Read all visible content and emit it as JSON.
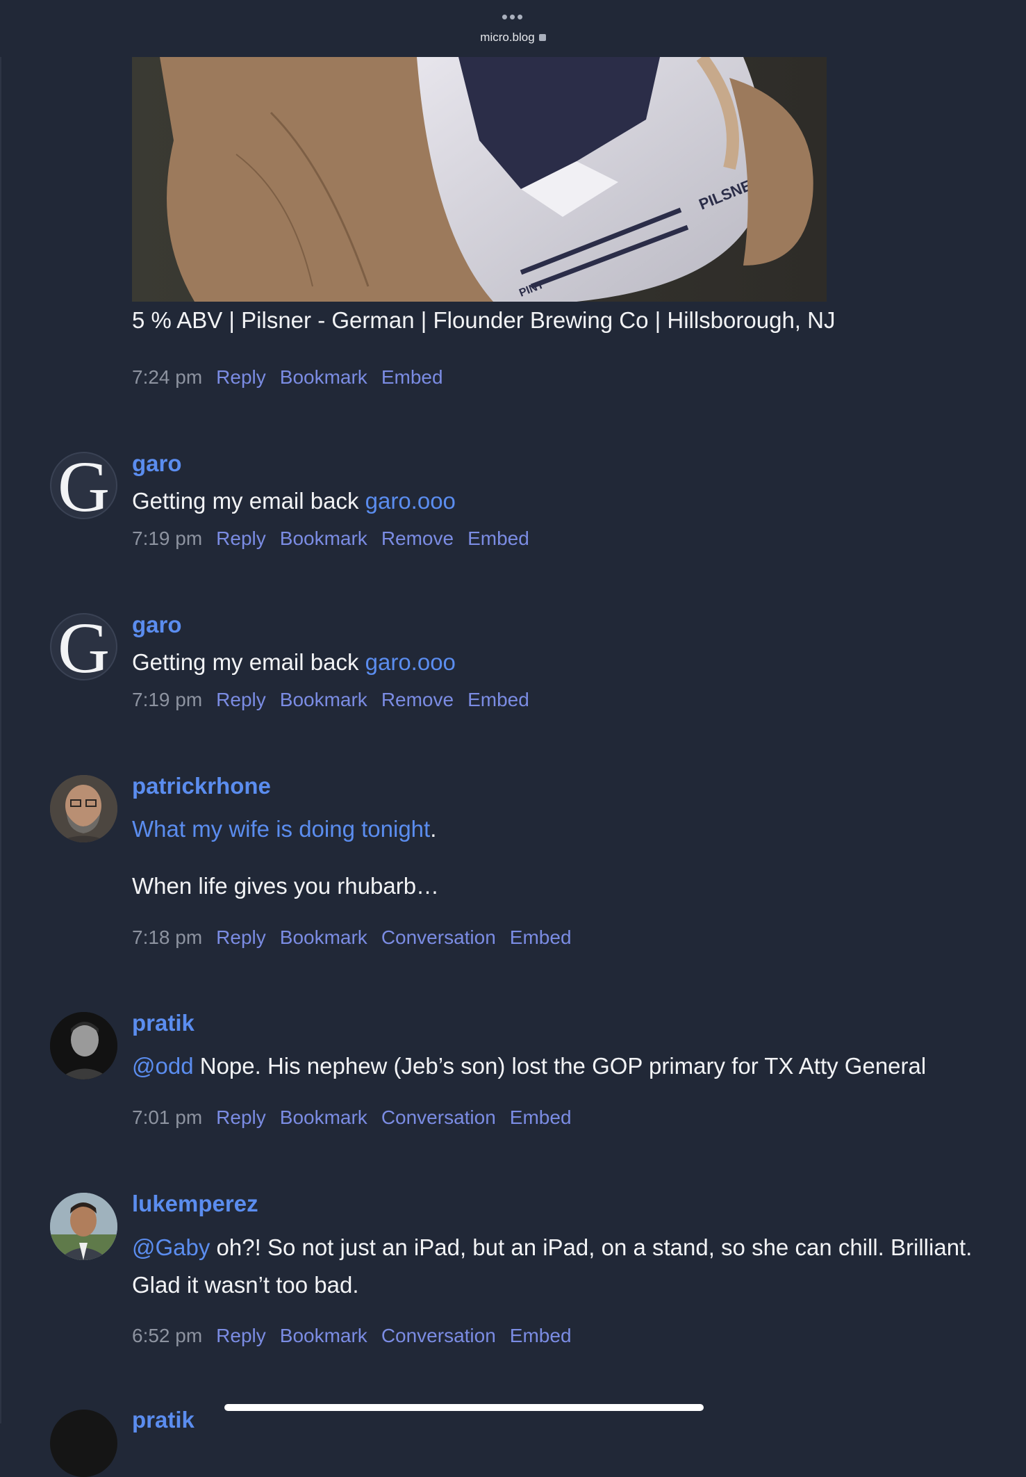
{
  "browser": {
    "url": "micro.blog"
  },
  "photo": {
    "can_text": "PILSNER",
    "pint_text": "PINT"
  },
  "posts": [
    {
      "text": "5 % ABV | Pilsner - German | Flounder Brewing Co | Hillsborough, NJ",
      "time": "7:24 pm",
      "actions": [
        "Reply",
        "Bookmark",
        "Embed"
      ]
    },
    {
      "username": "garo",
      "text_before": "Getting my email back ",
      "link": "garo.ooo",
      "time": "7:19 pm",
      "actions": [
        "Reply",
        "Bookmark",
        "Remove",
        "Embed"
      ]
    },
    {
      "username": "garo",
      "text_before": "Getting my email back ",
      "link": "garo.ooo",
      "time": "7:19 pm",
      "actions": [
        "Reply",
        "Bookmark",
        "Remove",
        "Embed"
      ]
    },
    {
      "username": "patrickrhone",
      "link": "What my wife is doing tonight",
      "after": ".",
      "text2": "When life gives you rhubarb…",
      "time": "7:18 pm",
      "actions": [
        "Reply",
        "Bookmark",
        "Conversation",
        "Embed"
      ]
    },
    {
      "username": "pratik",
      "mention": "@odd",
      "text": " Nope. His nephew (Jeb’s son) lost the GOP primary for TX Atty General",
      "time": "7:01 pm",
      "actions": [
        "Reply",
        "Bookmark",
        "Conversation",
        "Embed"
      ]
    },
    {
      "username": "lukemperez",
      "mention": "@Gaby",
      "text": " oh?! So not just an iPad, but an iPad, on a stand, so she can chill. Brilliant. Glad it wasn’t too bad.",
      "time": "6:52 pm",
      "actions": [
        "Reply",
        "Bookmark",
        "Conversation",
        "Embed"
      ]
    },
    {
      "username": "pratik"
    }
  ],
  "colors": {
    "background": "#212837",
    "link": "#5b8def",
    "action": "#7b8ce3",
    "meta": "#8d93a0"
  }
}
